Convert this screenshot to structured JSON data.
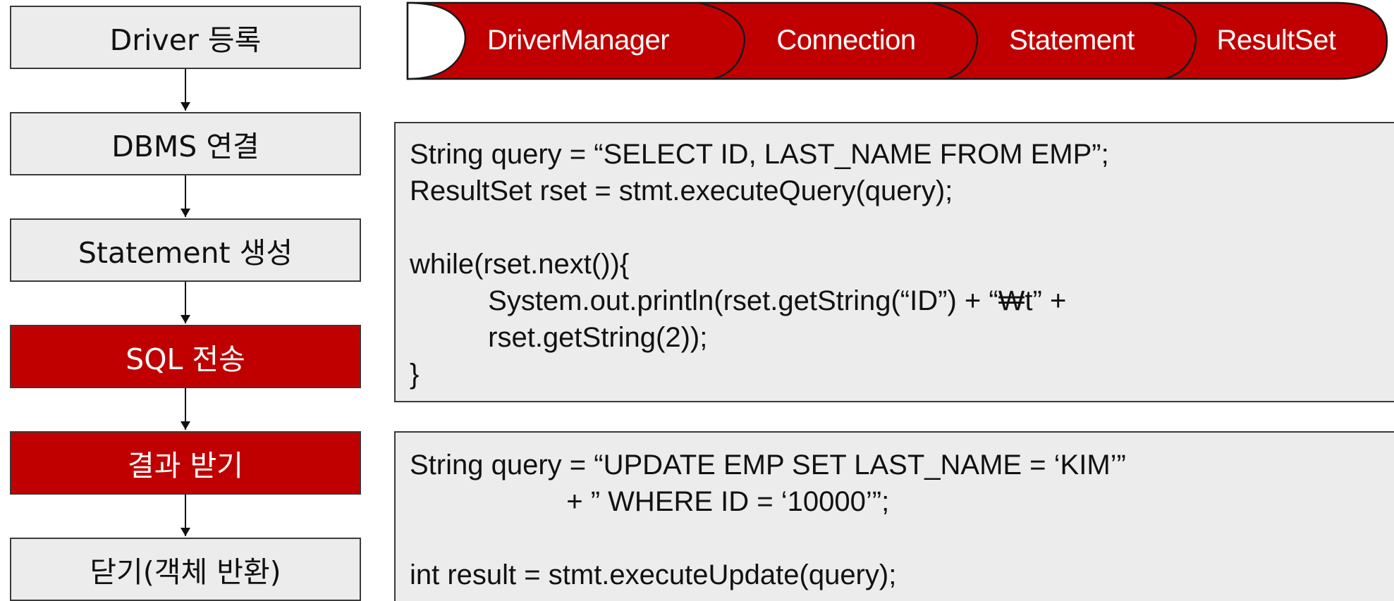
{
  "flow_steps": [
    {
      "label": "Driver 등록",
      "active": false
    },
    {
      "label": "DBMS 연결",
      "active": false
    },
    {
      "label": "Statement 생성",
      "active": false
    },
    {
      "label": "SQL 전송",
      "active": true
    },
    {
      "label": "결과 받기",
      "active": true
    },
    {
      "label": "닫기(객체 반환)",
      "active": false
    }
  ],
  "pipeline": [
    "DriverManager",
    "Connection",
    "Statement",
    "ResultSet"
  ],
  "query_code": [
    "String query = “SELECT ID, LAST_NAME FROM EMP”;",
    "ResultSet rset = stmt.executeQuery(query);",
    "",
    "while(rset.next()){",
    "          System.out.println(rset.getString(“ID”) + “₩t” +",
    "          rset.getString(2));",
    "}"
  ],
  "update_code": [
    "String query = “UPDATE EMP SET LAST_NAME = ‘KIM’”",
    "                    + ” WHERE ID = ‘10000’”;",
    "",
    "int result = stmt.executeUpdate(query);"
  ],
  "colors": {
    "accent": "#c00000",
    "box_fill": "#ececec",
    "border": "#3a3a3a"
  }
}
